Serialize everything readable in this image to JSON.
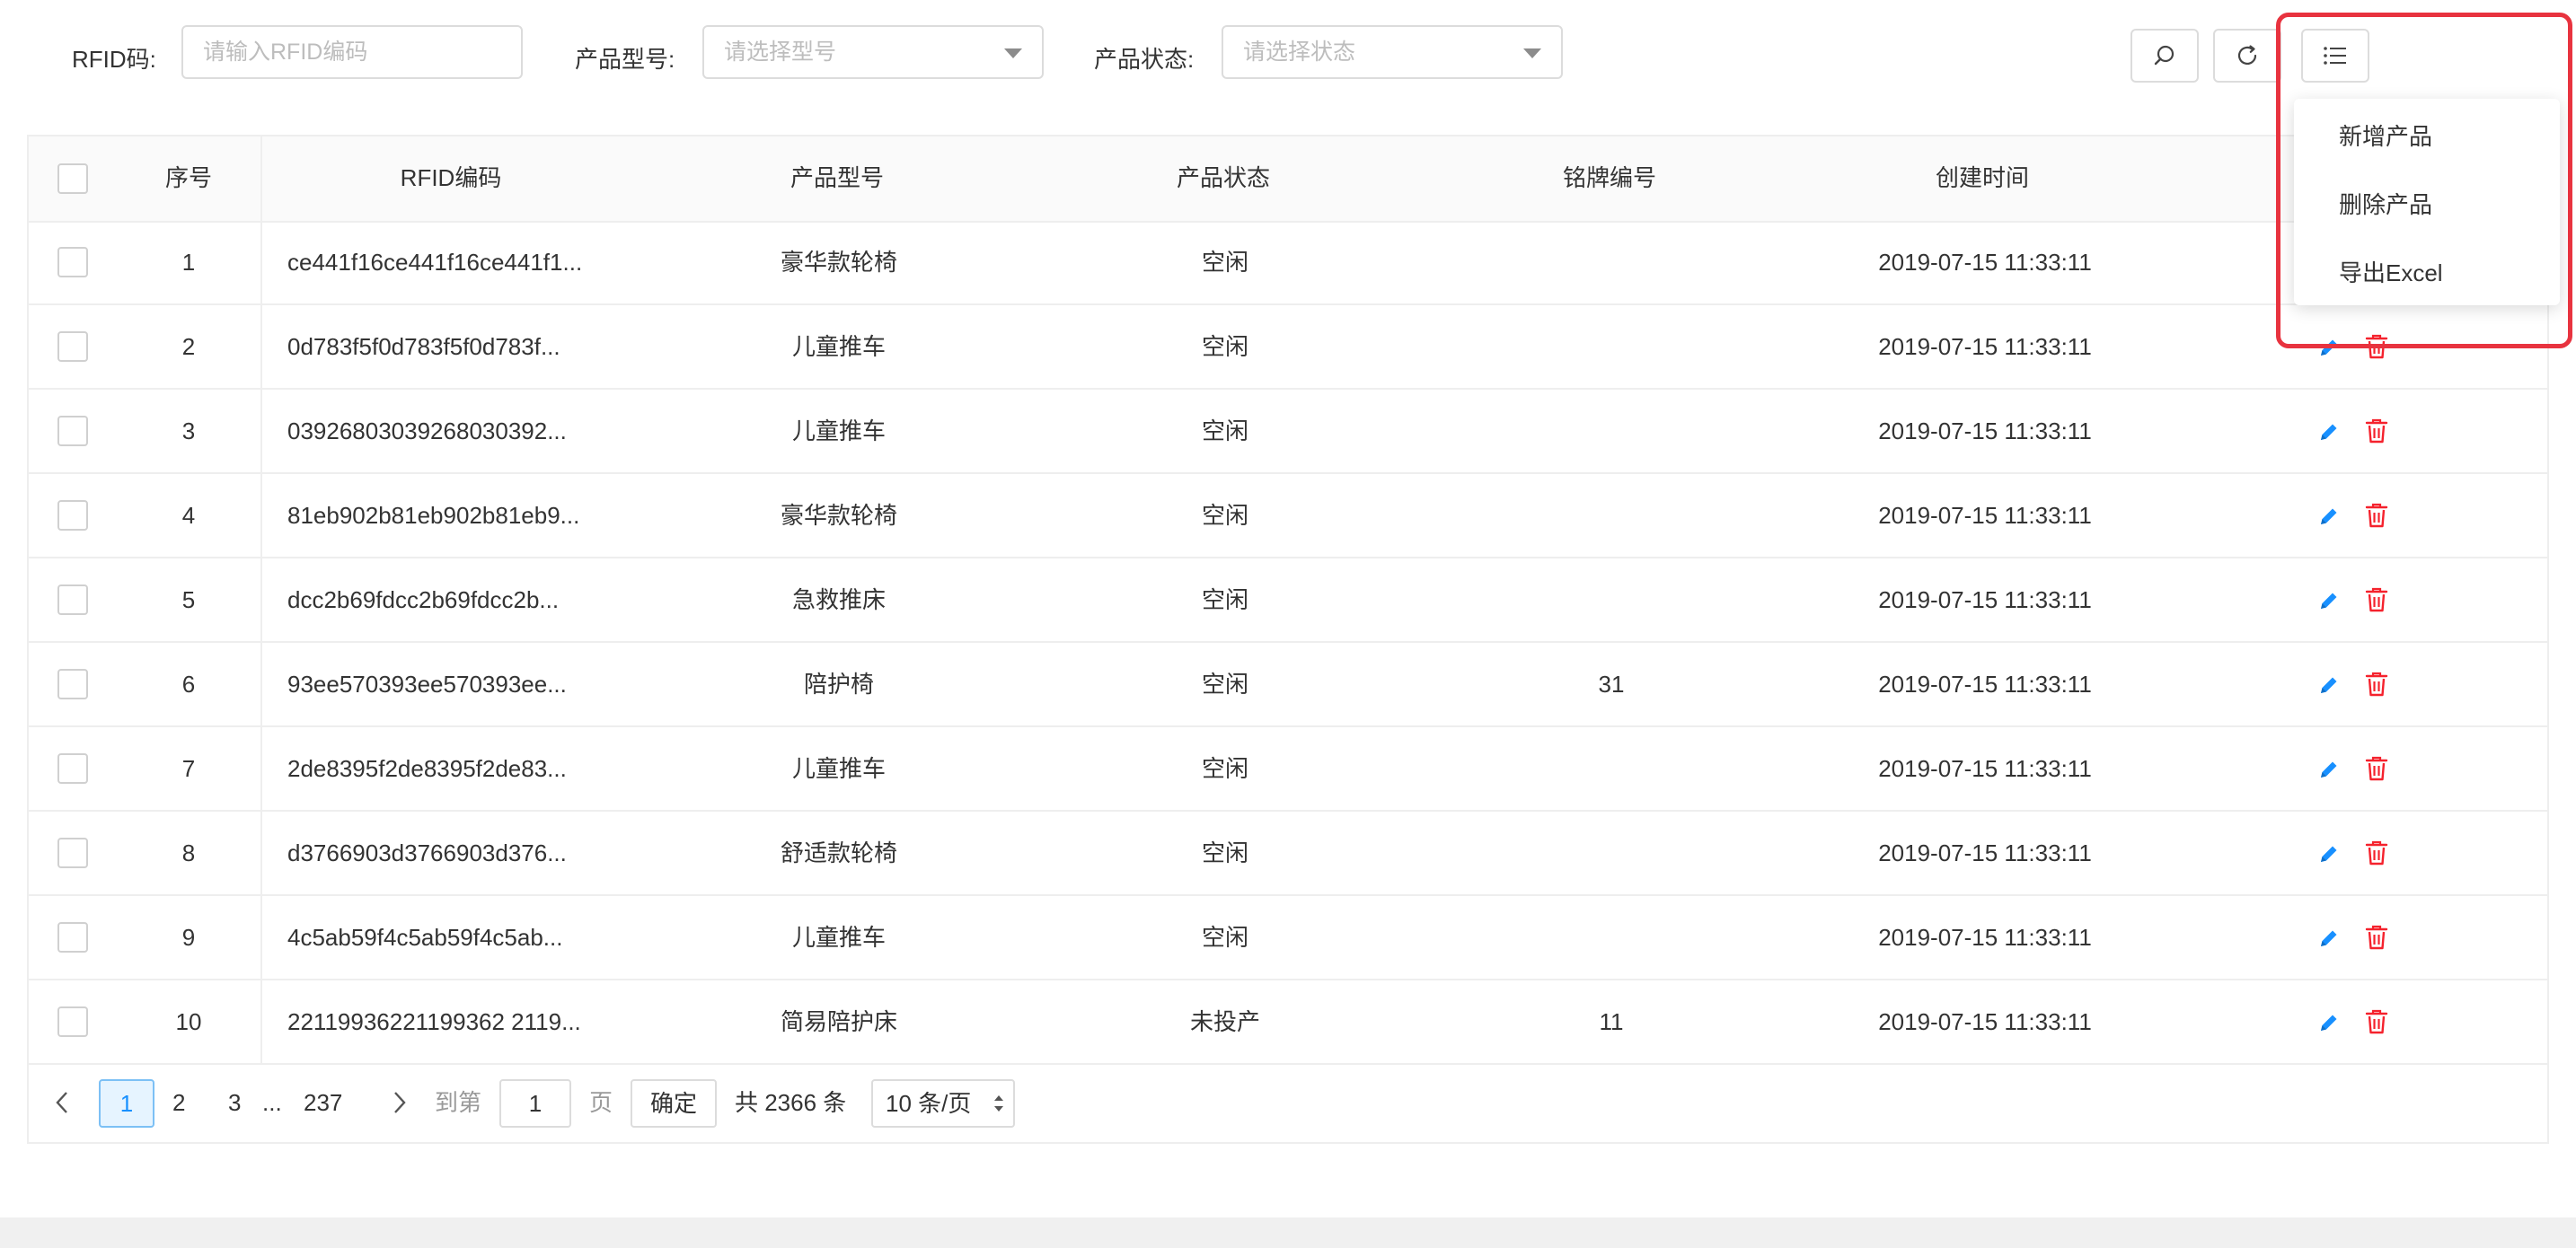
{
  "filters": {
    "rfid": {
      "label": "RFID码:",
      "placeholder": "请输入RFID编码"
    },
    "model": {
      "label": "产品型号:",
      "placeholder": "请选择型号"
    },
    "status": {
      "label": "产品状态:",
      "placeholder": "请选择状态"
    }
  },
  "toolbar": {
    "search_icon": "search-icon",
    "refresh_icon": "refresh-icon",
    "menu_icon": "list-icon"
  },
  "dropdown": {
    "items": [
      {
        "label": "新增产品"
      },
      {
        "label": "删除产品"
      },
      {
        "label": "导出Excel"
      }
    ]
  },
  "table": {
    "headers": {
      "index": "序号",
      "rfid": "RFID编码",
      "model": "产品型号",
      "status": "产品状态",
      "nameplate": "铭牌编号",
      "created": "创建时间"
    },
    "rows": [
      {
        "index": "1",
        "rfid": "ce441f16ce441f16ce441f1...",
        "model": "豪华款轮椅",
        "status": "空闲",
        "nameplate": "",
        "created": "2019-07-15 11:33:11"
      },
      {
        "index": "2",
        "rfid": "0d783f5f0d783f5f0d783f...",
        "model": "儿童推车",
        "status": "空闲",
        "nameplate": "",
        "created": "2019-07-15 11:33:11"
      },
      {
        "index": "3",
        "rfid": "03926803039268030392...",
        "model": "儿童推车",
        "status": "空闲",
        "nameplate": "",
        "created": "2019-07-15 11:33:11"
      },
      {
        "index": "4",
        "rfid": "81eb902b81eb902b81eb9...",
        "model": "豪华款轮椅",
        "status": "空闲",
        "nameplate": "",
        "created": "2019-07-15 11:33:11"
      },
      {
        "index": "5",
        "rfid": "dcc2b69fdcc2b69fdcc2b...",
        "model": "急救推床",
        "status": "空闲",
        "nameplate": "",
        "created": "2019-07-15 11:33:11"
      },
      {
        "index": "6",
        "rfid": "93ee570393ee570393ee...",
        "model": "陪护椅",
        "status": "空闲",
        "nameplate": "31",
        "created": "2019-07-15 11:33:11"
      },
      {
        "index": "7",
        "rfid": "2de8395f2de8395f2de83...",
        "model": "儿童推车",
        "status": "空闲",
        "nameplate": "",
        "created": "2019-07-15 11:33:11"
      },
      {
        "index": "8",
        "rfid": "d3766903d3766903d376...",
        "model": "舒适款轮椅",
        "status": "空闲",
        "nameplate": "",
        "created": "2019-07-15 11:33:11"
      },
      {
        "index": "9",
        "rfid": "4c5ab59f4c5ab59f4c5ab...",
        "model": "儿童推车",
        "status": "空闲",
        "nameplate": "",
        "created": "2019-07-15 11:33:11"
      },
      {
        "index": "10",
        "rfid": "22119936221199362 2119...",
        "model": "简易陪护床",
        "status": "未投产",
        "nameplate": "11",
        "created": "2019-07-15 11:33:11"
      }
    ]
  },
  "pagination": {
    "pages": [
      "1",
      "2",
      "3"
    ],
    "ellipsis": "...",
    "last_page": "237",
    "current_page": "1",
    "goto_prefix": "到第",
    "goto_value": "1",
    "goto_suffix": "页",
    "confirm_label": "确定",
    "total_label": "共 2366 条",
    "page_size_label": "10 条/页"
  },
  "colors": {
    "edit": "#1890ff",
    "delete": "#f5222d",
    "highlight": "#e8333f"
  }
}
